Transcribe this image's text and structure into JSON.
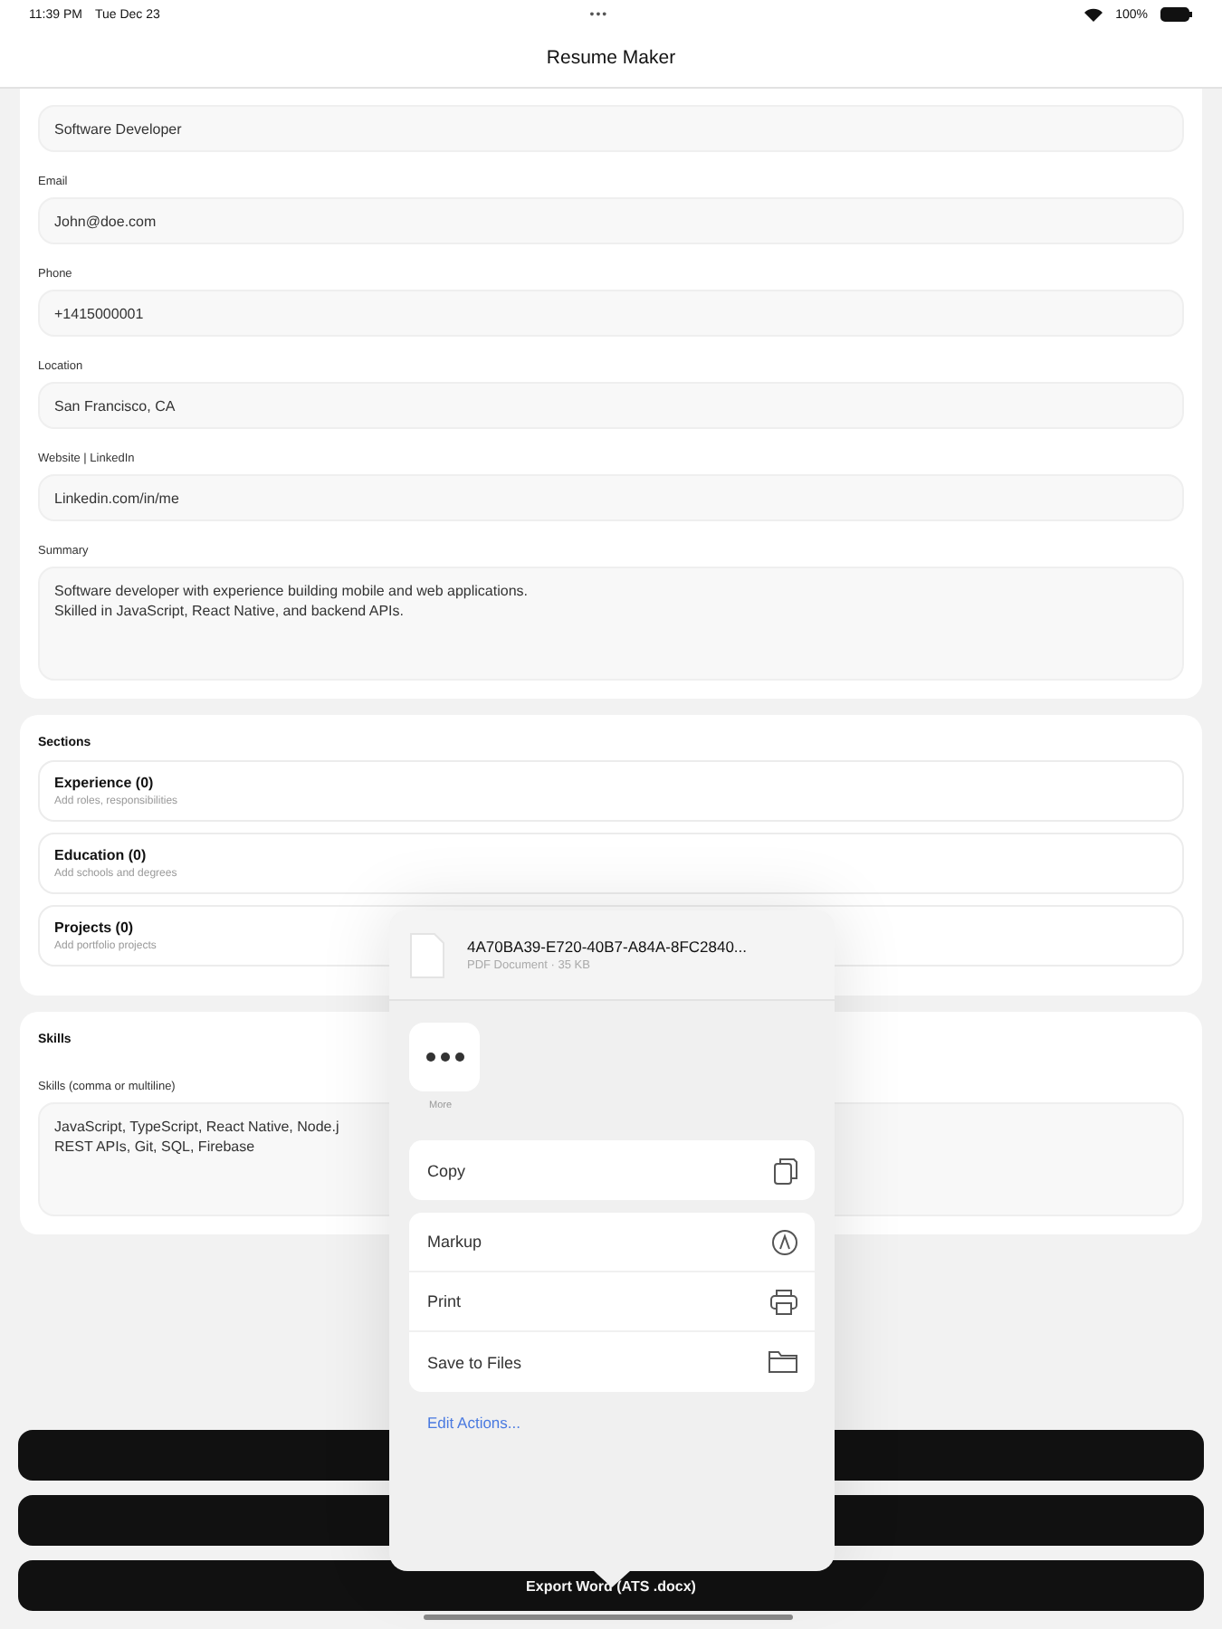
{
  "status_bar": {
    "time": "11:39 PM",
    "date": "Tue Dec 23",
    "dots": "•••",
    "battery": "100%"
  },
  "nav": {
    "title": "Resume Maker"
  },
  "profile_fields": [
    {
      "value": "Software Developer"
    },
    {
      "label": "Email",
      "value": "John@doe.com"
    },
    {
      "label": "Phone",
      "value": "+1415000001"
    },
    {
      "label": "Location",
      "value": "San Francisco, CA"
    },
    {
      "label": "Website | LinkedIn",
      "value": "Linkedin.com/in/me"
    },
    {
      "label": "Summary",
      "value": "Software developer with experience building mobile and web applications.\nSkilled in JavaScript, React Native, and backend APIs.",
      "kind": "multiline"
    }
  ],
  "sections": {
    "heading": "Sections",
    "items": [
      {
        "title": "Experience (0)",
        "subtitle": "Add roles, responsibilities"
      },
      {
        "title": "Education (0)",
        "subtitle": "Add schools and degrees"
      },
      {
        "title": "Projects (0)",
        "subtitle": "Add portfolio projects"
      }
    ]
  },
  "skills": {
    "heading": "Skills",
    "label": "Skills (comma or multiline)",
    "value": "JavaScript, TypeScript, React Native, Node.j\nREST APIs, Git, SQL, Firebase"
  },
  "bottom_buttons": [
    {
      "kind": "covered"
    },
    {
      "kind": "covered"
    },
    {
      "kind": "labeled",
      "label": "Export Word (ATS .docx)"
    }
  ],
  "share_sheet": {
    "file_name": "4A70BA39-E720-40B7-A84A-8FC2840...",
    "file_info": "PDF Document · 35 KB",
    "more_label": "More",
    "action_groups": [
      [
        {
          "label": "Copy",
          "kind": "copy"
        }
      ],
      [
        {
          "label": "Markup",
          "kind": "markup"
        },
        {
          "label": "Print",
          "kind": "print"
        },
        {
          "label": "Save to Files",
          "kind": "save"
        }
      ]
    ],
    "edit_actions": "Edit Actions..."
  }
}
